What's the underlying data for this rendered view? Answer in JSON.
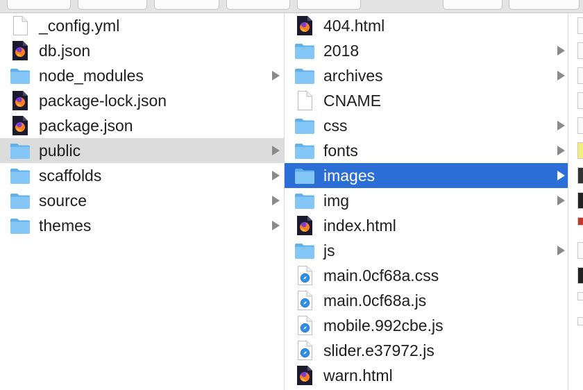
{
  "colors": {
    "selection_active": "#2a6ed6",
    "selection_inactive": "#dcdcdc",
    "folder": "#6cb8ee"
  },
  "column1": {
    "items": [
      {
        "label": "_config.yml",
        "icon": "document-icon",
        "folder": false,
        "state": ""
      },
      {
        "label": "db.json",
        "icon": "firefox-icon",
        "folder": false,
        "state": ""
      },
      {
        "label": "node_modules",
        "icon": "folder-icon",
        "folder": true,
        "state": ""
      },
      {
        "label": "package-lock.json",
        "icon": "firefox-icon",
        "folder": false,
        "state": ""
      },
      {
        "label": "package.json",
        "icon": "firefox-icon",
        "folder": false,
        "state": ""
      },
      {
        "label": "public",
        "icon": "folder-icon",
        "folder": true,
        "state": "selected-inactive"
      },
      {
        "label": "scaffolds",
        "icon": "folder-icon",
        "folder": true,
        "state": ""
      },
      {
        "label": "source",
        "icon": "folder-icon",
        "folder": true,
        "state": ""
      },
      {
        "label": "themes",
        "icon": "folder-icon",
        "folder": true,
        "state": ""
      }
    ]
  },
  "column2": {
    "items": [
      {
        "label": "404.html",
        "icon": "firefox-icon",
        "folder": false,
        "state": ""
      },
      {
        "label": "2018",
        "icon": "folder-icon",
        "folder": true,
        "state": ""
      },
      {
        "label": "archives",
        "icon": "folder-icon",
        "folder": true,
        "state": ""
      },
      {
        "label": "CNAME",
        "icon": "document-icon",
        "folder": false,
        "state": ""
      },
      {
        "label": "css",
        "icon": "folder-icon",
        "folder": true,
        "state": ""
      },
      {
        "label": "fonts",
        "icon": "folder-icon",
        "folder": true,
        "state": ""
      },
      {
        "label": "images",
        "icon": "folder-icon",
        "folder": true,
        "state": "selected-active"
      },
      {
        "label": "img",
        "icon": "folder-icon",
        "folder": true,
        "state": ""
      },
      {
        "label": "index.html",
        "icon": "firefox-icon",
        "folder": false,
        "state": ""
      },
      {
        "label": "js",
        "icon": "folder-icon",
        "folder": true,
        "state": ""
      },
      {
        "label": "main.0cf68a.css",
        "icon": "safari-doc-icon",
        "folder": false,
        "state": ""
      },
      {
        "label": "main.0cf68a.js",
        "icon": "safari-doc-icon",
        "folder": false,
        "state": ""
      },
      {
        "label": "mobile.992cbe.js",
        "icon": "safari-doc-icon",
        "folder": false,
        "state": ""
      },
      {
        "label": "slider.e37972.js",
        "icon": "safari-doc-icon",
        "folder": false,
        "state": ""
      },
      {
        "label": "warn.html",
        "icon": "firefox-icon",
        "folder": false,
        "state": ""
      }
    ]
  }
}
